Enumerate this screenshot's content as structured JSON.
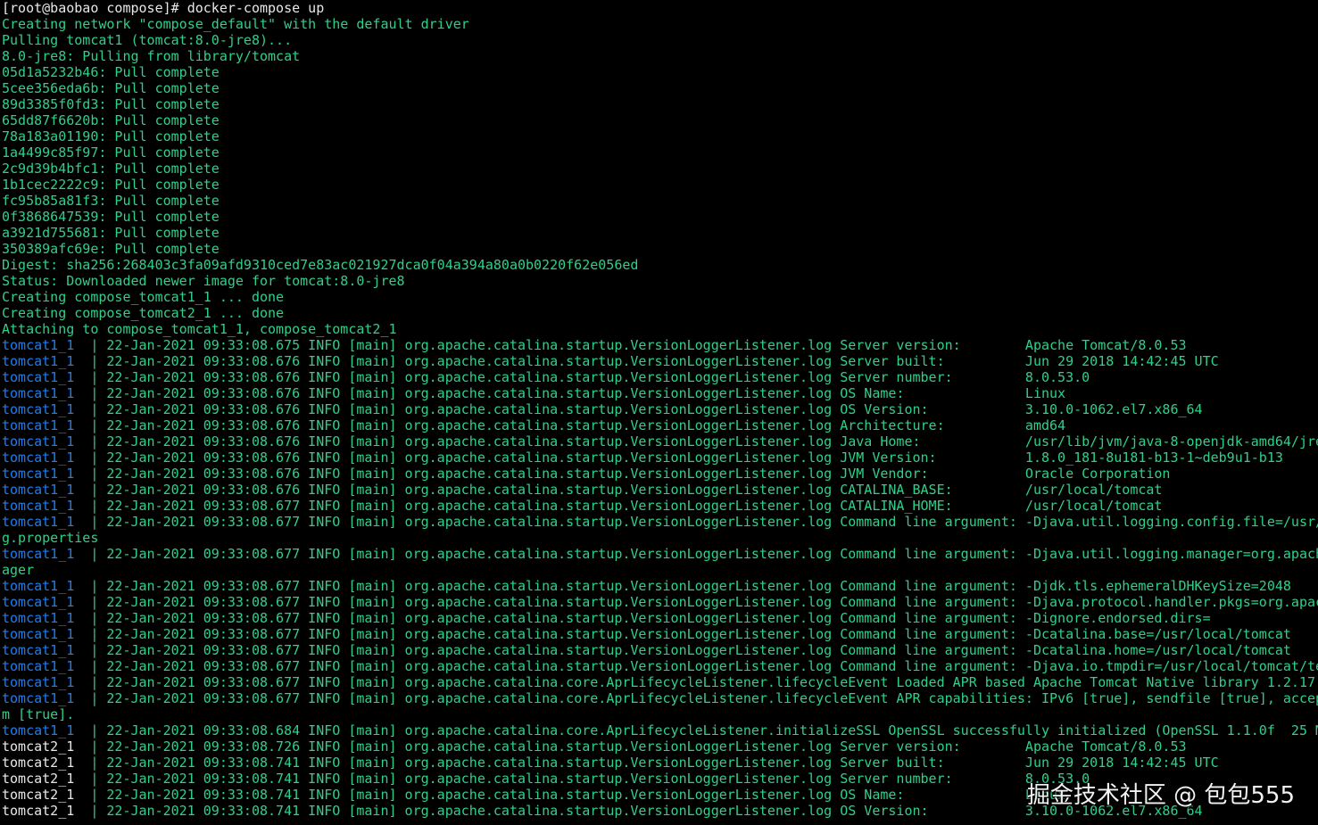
{
  "colors": {
    "background": "#000000",
    "default_text": "#2fd08a",
    "prompt_text": "#e8e8e8",
    "tomcat1_prefix": "#1d7df0",
    "tomcat2_prefix": "#e8e8e8"
  },
  "terminal": {
    "prompt": "[root@baobao compose]# docker-compose up",
    "preamble": [
      "Creating network \"compose_default\" with the default driver",
      "Pulling tomcat1 (tomcat:8.0-jre8)...",
      "8.0-jre8: Pulling from library/tomcat",
      "05d1a5232b46: Pull complete",
      "5cee356eda6b: Pull complete",
      "89d3385f0fd3: Pull complete",
      "65dd87f6620b: Pull complete",
      "78a183a01190: Pull complete",
      "1a4499c85f97: Pull complete",
      "2c9d39b4bfc1: Pull complete",
      "1b1cec2222c9: Pull complete",
      "fc95b85a81f3: Pull complete",
      "0f3868647539: Pull complete",
      "a3921d755681: Pull complete",
      "350389afc69e: Pull complete",
      "Digest: sha256:268403c3fa09afd9310ced7e83ac021927dca0f04a394a80a0b0220f62e056ed",
      "Status: Downloaded newer image for tomcat:8.0-jre8",
      "Creating compose_tomcat1_1 ... done",
      "Creating compose_tomcat2_1 ... done",
      "Attaching to compose_tomcat1_1, compose_tomcat2_1"
    ],
    "log_lines": [
      {
        "prefix": "tomcat1_1",
        "text": "22-Jan-2021 09:33:08.675 INFO [main] org.apache.catalina.startup.VersionLoggerListener.log Server version:        Apache Tomcat/8.0.53"
      },
      {
        "prefix": "tomcat1_1",
        "text": "22-Jan-2021 09:33:08.676 INFO [main] org.apache.catalina.startup.VersionLoggerListener.log Server built:          Jun 29 2018 14:42:45 UTC"
      },
      {
        "prefix": "tomcat1_1",
        "text": "22-Jan-2021 09:33:08.676 INFO [main] org.apache.catalina.startup.VersionLoggerListener.log Server number:         8.0.53.0"
      },
      {
        "prefix": "tomcat1_1",
        "text": "22-Jan-2021 09:33:08.676 INFO [main] org.apache.catalina.startup.VersionLoggerListener.log OS Name:               Linux"
      },
      {
        "prefix": "tomcat1_1",
        "text": "22-Jan-2021 09:33:08.676 INFO [main] org.apache.catalina.startup.VersionLoggerListener.log OS Version:            3.10.0-1062.el7.x86_64"
      },
      {
        "prefix": "tomcat1_1",
        "text": "22-Jan-2021 09:33:08.676 INFO [main] org.apache.catalina.startup.VersionLoggerListener.log Architecture:          amd64"
      },
      {
        "prefix": "tomcat1_1",
        "text": "22-Jan-2021 09:33:08.676 INFO [main] org.apache.catalina.startup.VersionLoggerListener.log Java Home:             /usr/lib/jvm/java-8-openjdk-amd64/jre"
      },
      {
        "prefix": "tomcat1_1",
        "text": "22-Jan-2021 09:33:08.676 INFO [main] org.apache.catalina.startup.VersionLoggerListener.log JVM Version:           1.8.0_181-8u181-b13-1~deb9u1-b13"
      },
      {
        "prefix": "tomcat1_1",
        "text": "22-Jan-2021 09:33:08.676 INFO [main] org.apache.catalina.startup.VersionLoggerListener.log JVM Vendor:            Oracle Corporation"
      },
      {
        "prefix": "tomcat1_1",
        "text": "22-Jan-2021 09:33:08.676 INFO [main] org.apache.catalina.startup.VersionLoggerListener.log CATALINA_BASE:         /usr/local/tomcat"
      },
      {
        "prefix": "tomcat1_1",
        "text": "22-Jan-2021 09:33:08.677 INFO [main] org.apache.catalina.startup.VersionLoggerListener.log CATALINA_HOME:         /usr/local/tomcat"
      },
      {
        "prefix": "tomcat1_1",
        "text": "22-Jan-2021 09:33:08.677 INFO [main] org.apache.catalina.startup.VersionLoggerListener.log Command line argument: -Djava.util.logging.config.file=/usr/"
      },
      {
        "prefix": "",
        "text": "g.properties"
      },
      {
        "prefix": "tomcat1_1",
        "text": "22-Jan-2021 09:33:08.677 INFO [main] org.apache.catalina.startup.VersionLoggerListener.log Command line argument: -Djava.util.logging.manager=org.apach"
      },
      {
        "prefix": "",
        "text": "ager"
      },
      {
        "prefix": "tomcat1_1",
        "text": "22-Jan-2021 09:33:08.677 INFO [main] org.apache.catalina.startup.VersionLoggerListener.log Command line argument: -Djdk.tls.ephemeralDHKeySize=2048"
      },
      {
        "prefix": "tomcat1_1",
        "text": "22-Jan-2021 09:33:08.677 INFO [main] org.apache.catalina.startup.VersionLoggerListener.log Command line argument: -Djava.protocol.handler.pkgs=org.apac"
      },
      {
        "prefix": "tomcat1_1",
        "text": "22-Jan-2021 09:33:08.677 INFO [main] org.apache.catalina.startup.VersionLoggerListener.log Command line argument: -Dignore.endorsed.dirs="
      },
      {
        "prefix": "tomcat1_1",
        "text": "22-Jan-2021 09:33:08.677 INFO [main] org.apache.catalina.startup.VersionLoggerListener.log Command line argument: -Dcatalina.base=/usr/local/tomcat"
      },
      {
        "prefix": "tomcat1_1",
        "text": "22-Jan-2021 09:33:08.677 INFO [main] org.apache.catalina.startup.VersionLoggerListener.log Command line argument: -Dcatalina.home=/usr/local/tomcat"
      },
      {
        "prefix": "tomcat1_1",
        "text": "22-Jan-2021 09:33:08.677 INFO [main] org.apache.catalina.startup.VersionLoggerListener.log Command line argument: -Djava.io.tmpdir=/usr/local/tomcat/te"
      },
      {
        "prefix": "tomcat1_1",
        "text": "22-Jan-2021 09:33:08.677 INFO [main] org.apache.catalina.core.AprLifecycleListener.lifecycleEvent Loaded APR based Apache Tomcat Native library 1.2.17"
      },
      {
        "prefix": "tomcat1_1",
        "text": "22-Jan-2021 09:33:08.677 INFO [main] org.apache.catalina.core.AprLifecycleListener.lifecycleEvent APR capabilities: IPv6 [true], sendfile [true], accep"
      },
      {
        "prefix": "",
        "text": "m [true]."
      },
      {
        "prefix": "tomcat1_1",
        "text": "22-Jan-2021 09:33:08.684 INFO [main] org.apache.catalina.core.AprLifecycleListener.initializeSSL OpenSSL successfully initialized (OpenSSL 1.1.0f  25 M"
      },
      {
        "prefix": "tomcat2_1",
        "text": "22-Jan-2021 09:33:08.726 INFO [main] org.apache.catalina.startup.VersionLoggerListener.log Server version:        Apache Tomcat/8.0.53"
      },
      {
        "prefix": "tomcat2_1",
        "text": "22-Jan-2021 09:33:08.741 INFO [main] org.apache.catalina.startup.VersionLoggerListener.log Server built:          Jun 29 2018 14:42:45 UTC"
      },
      {
        "prefix": "tomcat2_1",
        "text": "22-Jan-2021 09:33:08.741 INFO [main] org.apache.catalina.startup.VersionLoggerListener.log Server number:         8.0.53.0"
      },
      {
        "prefix": "tomcat2_1",
        "text": "22-Jan-2021 09:33:08.741 INFO [main] org.apache.catalina.startup.VersionLoggerListener.log OS Name:               Linux"
      },
      {
        "prefix": "tomcat2_1",
        "text": "22-Jan-2021 09:33:08.741 INFO [main] org.apache.catalina.startup.VersionLoggerListener.log OS Version:            3.10.0-1062.el7.x86_64"
      }
    ]
  },
  "watermark": "掘金技术社区 @ 包包555"
}
